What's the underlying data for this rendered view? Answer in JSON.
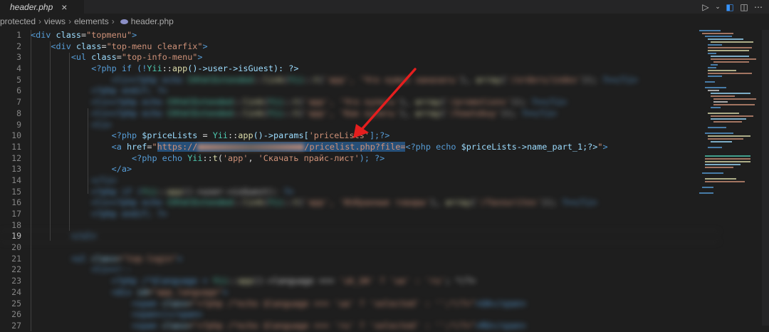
{
  "tab": {
    "label": "header.php",
    "close": "×"
  },
  "breadcrumb": [
    "protected",
    "views",
    "elements",
    "header.php"
  ],
  "lines": [
    "1",
    "2",
    "3",
    "4",
    "5",
    "6",
    "7",
    "8",
    "9",
    "10",
    "11",
    "12",
    "13",
    "14",
    "15",
    "16",
    "17",
    "18",
    "19",
    "20",
    "21",
    "22",
    "23",
    "24",
    "25",
    "26",
    "27"
  ],
  "active_line": "19",
  "code": {
    "l1": {
      "tag_open": "<div ",
      "attr": "class",
      "eq": "=",
      "val": "\"topmenu\"",
      "close": ">"
    },
    "l2": {
      "tag_open": "<div ",
      "attr": "class",
      "eq": "=",
      "val": "\"top-menu clearfix\"",
      "close": ">"
    },
    "l3": {
      "tag_open": "<ul ",
      "attr": "class",
      "eq": "=",
      "val": "\"top-info-menu\"",
      "close": ">"
    },
    "l4": {
      "php": "<?php if (!",
      "cls": "Yii",
      "mid": "::",
      "fn": "app",
      "rest": "()->user->isGuest): ?>"
    },
    "l10": {
      "php": "<?php ",
      "var": "$priceLists",
      "eq": " = ",
      "cls": "Yii",
      "mid": "::",
      "fn": "app",
      "rest": "()->params[",
      "str": "'priceLists'",
      "end": "];?>"
    },
    "l11": {
      "tag": "<a ",
      "attr": "href",
      "eq": "=",
      "q": "\"",
      "url_head": "https://",
      "url_tail": "/pricelist.php?file=",
      "php": "<?php echo ",
      "var": "$priceLists",
      "rest": "->name_part_1;?>",
      "q2": "\"",
      "gt": ">"
    },
    "l12": {
      "php": "<?php echo ",
      "cls": "Yii",
      "mid": "::",
      "fn": "t",
      "open": "(",
      "s1": "'app'",
      "comma": ", ",
      "s2": "'Скачать прайс-лист'",
      "end": "); ?>"
    },
    "l13": {
      "tag": "</a>"
    }
  },
  "colors": {
    "bg": "#1e1e1e",
    "tag": "#569cd6",
    "attr": "#9cdcfe",
    "string": "#ce9178",
    "function": "#dcdcaa",
    "class": "#4ec9b0",
    "arrow": "#e51e1e"
  },
  "icons": [
    "run-icon",
    "chevron-down-icon",
    "compare-icon",
    "split-editor-icon",
    "more-icon"
  ]
}
